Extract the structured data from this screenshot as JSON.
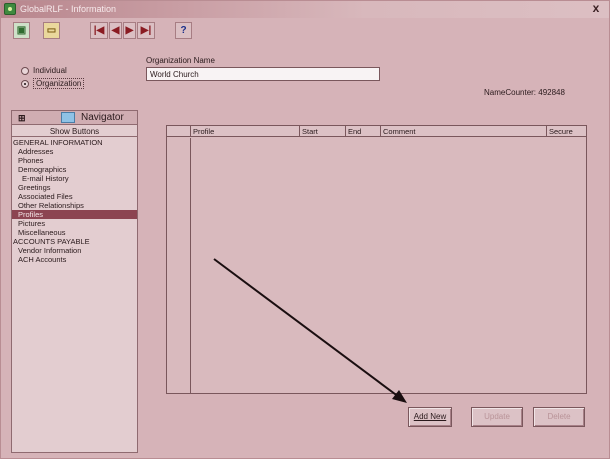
{
  "window": {
    "title": "GlobalRLF - Information",
    "close_glyph": "x"
  },
  "toolbar": {
    "buttons": [
      {
        "name": "save-icon",
        "glyph": "▣"
      },
      {
        "name": "folder-icon",
        "glyph": "▭"
      },
      {
        "name": "first-record-icon",
        "glyph": "|◀"
      },
      {
        "name": "prev-record-icon",
        "glyph": "◀"
      },
      {
        "name": "next-record-icon",
        "glyph": "▶"
      },
      {
        "name": "last-record-icon",
        "glyph": "▶|"
      },
      {
        "name": "help-icon",
        "glyph": "?"
      }
    ]
  },
  "entity_type": {
    "individual_label": "Individual",
    "organization_label": "Organization",
    "selected": "Organization"
  },
  "organization": {
    "label": "Organization Name",
    "value": "World Church"
  },
  "counter": {
    "text": "NameCounter: 492848"
  },
  "navigator": {
    "title": "Navigator",
    "pin_glyph": "⊞",
    "show_buttons_label": "Show Buttons",
    "items": [
      {
        "label": "GENERAL INFORMATION",
        "level": "top"
      },
      {
        "label": "Addresses",
        "level": "sub"
      },
      {
        "label": "Phones",
        "level": "sub"
      },
      {
        "label": "Demographics",
        "level": "sub"
      },
      {
        "label": "E-mail History",
        "level": "sub2"
      },
      {
        "label": "Greetings",
        "level": "sub"
      },
      {
        "label": "Associated Files",
        "level": "sub"
      },
      {
        "label": "Other Relationships",
        "level": "sub"
      },
      {
        "label": "Profiles",
        "level": "sub",
        "selected": true
      },
      {
        "label": "Pictures",
        "level": "sub"
      },
      {
        "label": "Miscellaneous",
        "level": "sub"
      },
      {
        "label": "ACCOUNTS PAYABLE",
        "level": "top"
      },
      {
        "label": "Vendor Information",
        "level": "sub"
      },
      {
        "label": "ACH Accounts",
        "level": "sub"
      }
    ]
  },
  "profile_grid": {
    "columns": [
      "Profile",
      "Start",
      "End",
      "Comment",
      "Secure"
    ]
  },
  "actions": {
    "add_new_label": "Add New",
    "update_label": "Update",
    "delete_label": "Delete"
  },
  "colors": {
    "background": "#d6b3b8",
    "selected_item": "#8c4451",
    "arrow": "#1a0e10"
  }
}
